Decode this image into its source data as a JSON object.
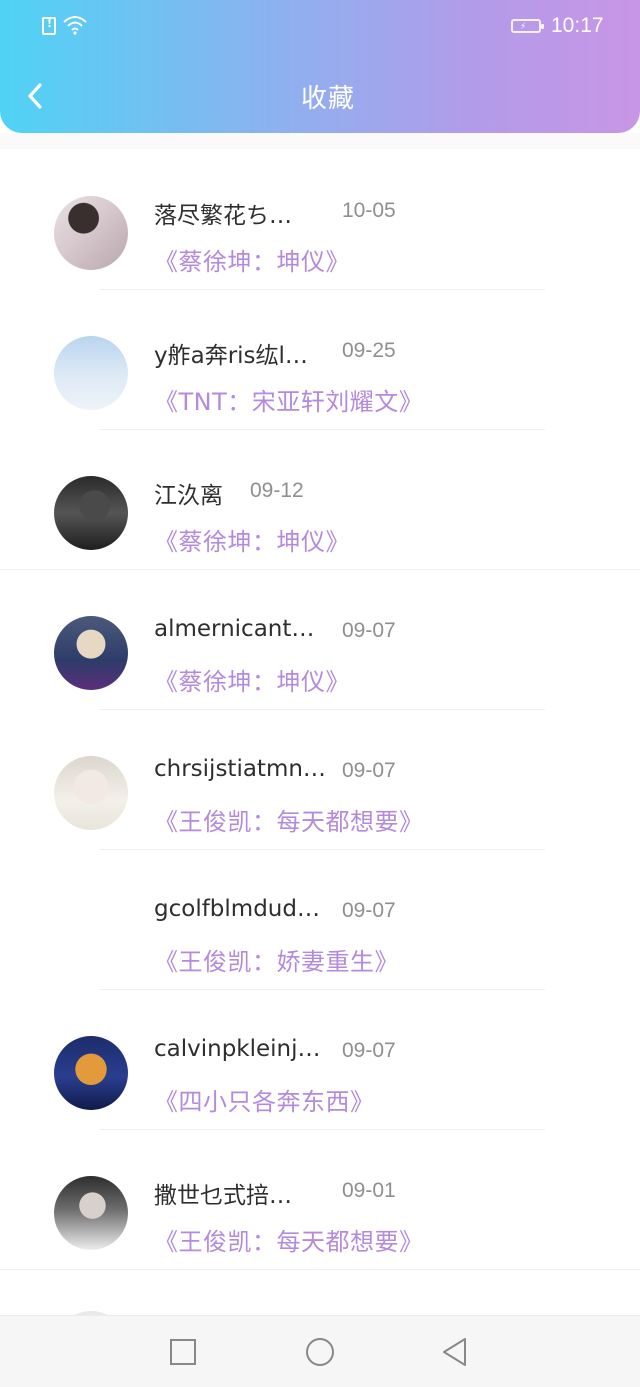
{
  "status_bar": {
    "time": "10:17",
    "icons": [
      "alert-icon",
      "wifi-icon",
      "battery-charging-icon"
    ]
  },
  "header": {
    "title": "收藏",
    "back_icon": "chevron-left-icon"
  },
  "favorites": [
    {
      "name": "落尽繁花ち…",
      "date": "10-05",
      "title": "《蔡徐坤：坤仪》",
      "avatar": "photo"
    },
    {
      "name": "y舴a奔ris纮l…",
      "date": "09-25",
      "title": "《TNT：宋亚轩刘耀文》",
      "avatar": "photo"
    },
    {
      "name": "江汣离",
      "date": "09-12",
      "title": "《蔡徐坤：坤仪》",
      "avatar": "photo"
    },
    {
      "name": "almernicant…",
      "date": "09-07",
      "title": "《蔡徐坤：坤仪》",
      "avatar": "photo"
    },
    {
      "name": "chrsijstiatmn…",
      "date": "09-07",
      "title": "《王俊凯：每天都想要》",
      "avatar": "photo"
    },
    {
      "name": "gcolfblmdud…",
      "date": "09-07",
      "title": "《王俊凯：娇妻重生》",
      "avatar": "none"
    },
    {
      "name": "calvinpkleinj…",
      "date": "09-07",
      "title": "《四小只各奔东西》",
      "avatar": "photo"
    },
    {
      "name": "撒世乜式掊…",
      "date": "09-01",
      "title": "《王俊凯：每天都想要》",
      "avatar": "photo"
    }
  ],
  "nav_bar": {
    "buttons": [
      "recent-apps-square-icon",
      "home-circle-icon",
      "back-triangle-icon"
    ]
  },
  "colors": {
    "header_gradient_start": "#4fd3f5",
    "header_gradient_end": "#c896e6",
    "title_purple": "#b48bdc",
    "name_text": "#2e2e2e",
    "date_text": "#8f8f8f"
  }
}
